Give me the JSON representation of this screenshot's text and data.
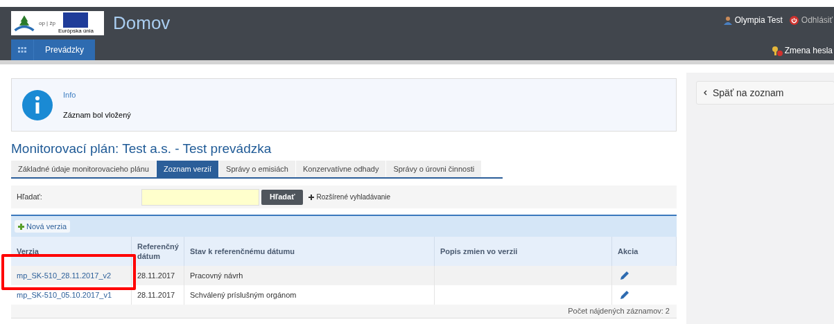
{
  "header": {
    "title": "Domov",
    "user": "Olympia Test",
    "logout": "Odhlásiť",
    "change_password": "Zmena hesla",
    "logo_caption": "Európska únia",
    "logo_text": "op | žp"
  },
  "nav": {
    "items": [
      {
        "label": "Prevádzky",
        "selected": true
      }
    ]
  },
  "info": {
    "title": "Info",
    "message": "Záznam bol vložený"
  },
  "page_title": "Monitorovací plán: Test a.s. - Test prevádzka",
  "tabs": [
    {
      "label": "Základné údaje monitorovacieho plánu",
      "selected": false
    },
    {
      "label": "Zoznam verzií",
      "selected": true
    },
    {
      "label": "Správy o emisiách",
      "selected": false
    },
    {
      "label": "Konzervatívne odhady",
      "selected": false
    },
    {
      "label": "Správy o úrovni činnosti",
      "selected": false
    }
  ],
  "search": {
    "label": "Hľadať:",
    "button": "Hľadať",
    "advanced": "Rozšírené vyhladávanie"
  },
  "table": {
    "new_button": "Nová verzia",
    "columns": [
      "Verzia",
      "Referenčný dátum",
      "Stav k referenčnému dátumu",
      "Popis zmien vo verzii",
      "Akcia"
    ],
    "rows": [
      {
        "version": "mp_SK-510_28.11.2017_v2",
        "date": "28.11.2017",
        "status": "Pracovný návrh",
        "description": ""
      },
      {
        "version": "mp_SK-510_05.10.2017_v1",
        "date": "28.11.2017",
        "status": "Schválený príslušným orgánom",
        "description": ""
      }
    ],
    "footer": "Počet nájdených záznamov: 2"
  },
  "sidebar": {
    "back": "Späť na zoznam"
  }
}
